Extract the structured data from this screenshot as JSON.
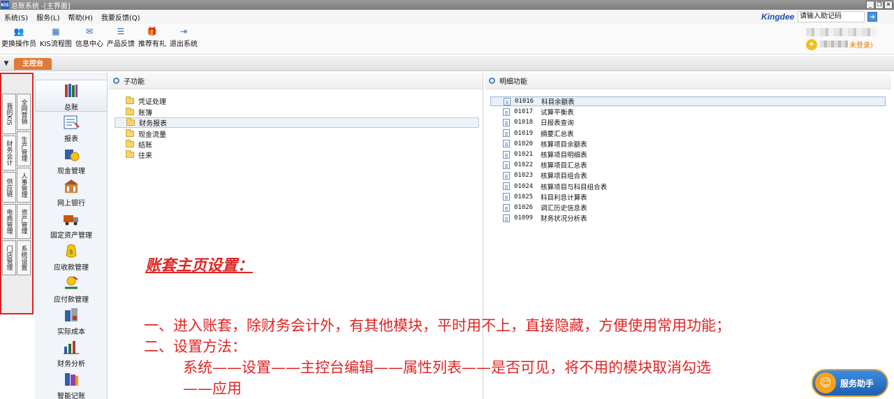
{
  "window": {
    "logo": "KIS",
    "title": "总账系统 -[主界面]",
    "min_glyph": "_",
    "restore_glyph": "❐",
    "close_glyph": "✕"
  },
  "menubar": {
    "items": [
      "系统(S)",
      "服务(L)",
      "帮助(H)",
      "我要反馈(Q)"
    ],
    "brand": "Kingdee",
    "help_code_value": "请输入助记码",
    "go_glyph": "➔"
  },
  "toolbar": {
    "items": [
      {
        "label": "更换操作员",
        "icon": "user-switch-icon",
        "glyph": "👥"
      },
      {
        "label": "KIS流程图",
        "icon": "flowchart-icon",
        "glyph": "▦"
      },
      {
        "label": "信息中心",
        "icon": "message-icon",
        "glyph": "✉"
      },
      {
        "label": "产品反馈",
        "icon": "feedback-icon",
        "glyph": "☰"
      },
      {
        "label": "推荐有礼",
        "icon": "gift-icon",
        "glyph": "🎁"
      },
      {
        "label": "退出系统",
        "icon": "exit-icon",
        "glyph": "⇥"
      }
    ],
    "user_status": "未登录)",
    "star_glyph": "✦"
  },
  "tabstrip": {
    "arrow_glyph": "▼",
    "main_tab": "主控台"
  },
  "vertical_tabs": {
    "left": [
      "我的KIS",
      "财务会计",
      "供应链",
      "电商管理",
      "门店管理"
    ],
    "right": [
      "全网营销",
      "生产管理",
      "人事管理",
      "资产管理",
      "系统设置"
    ]
  },
  "modules": [
    {
      "label": "总账",
      "icon": "ledger-books-icon"
    },
    {
      "label": "报表",
      "icon": "report-icon"
    },
    {
      "label": "现金管理",
      "icon": "cash-icon"
    },
    {
      "label": "网上银行",
      "icon": "bank-icon"
    },
    {
      "label": "固定资产管理",
      "icon": "truck-icon"
    },
    {
      "label": "应收款管理",
      "icon": "receivable-icon"
    },
    {
      "label": "应付款管理",
      "icon": "payable-icon"
    },
    {
      "label": "实际成本",
      "icon": "cost-icon"
    },
    {
      "label": "财务分析",
      "icon": "analysis-icon"
    },
    {
      "label": "智能记账",
      "icon": "smart-accounting-icon"
    }
  ],
  "sub_panel": {
    "title": "子功能",
    "items": [
      "凭证处理",
      "账簿",
      "财务报表",
      "现金流量",
      "结账",
      "往来"
    ]
  },
  "detail_panel": {
    "title": "明细功能",
    "items": [
      {
        "code": "01016",
        "name": "科目余额表"
      },
      {
        "code": "01017",
        "name": "试算平衡表"
      },
      {
        "code": "01018",
        "name": "日报表查询"
      },
      {
        "code": "01019",
        "name": "摘要汇总表"
      },
      {
        "code": "01020",
        "name": "核算项目余额表"
      },
      {
        "code": "01021",
        "name": "核算项目明细表"
      },
      {
        "code": "01022",
        "name": "核算项目汇总表"
      },
      {
        "code": "01023",
        "name": "核算项目组合表"
      },
      {
        "code": "01024",
        "name": "核算项目与科目组合表"
      },
      {
        "code": "01025",
        "name": "科目利息计算表"
      },
      {
        "code": "01026",
        "name": "调汇历史信息表"
      },
      {
        "code": "01099",
        "name": "财务状况分析表"
      }
    ]
  },
  "annotation": {
    "title": "账套主页设置：",
    "line1": "一、进入账套，除财务会计外，有其他模块，平时用不上，直接隐藏，方便使用常用功能；",
    "line2": "二、设置方法：",
    "line3": "系统——设置——主控台编辑——属性列表——是否可见，将不用的模块取消勾选",
    "line4": "——应用"
  },
  "service_helper": {
    "label": "服务助手",
    "glyph": "☺"
  },
  "colors": {
    "accent_red": "#e02424",
    "tab_orange": "#e07a3a",
    "brand_blue": "#1f4fa3"
  }
}
